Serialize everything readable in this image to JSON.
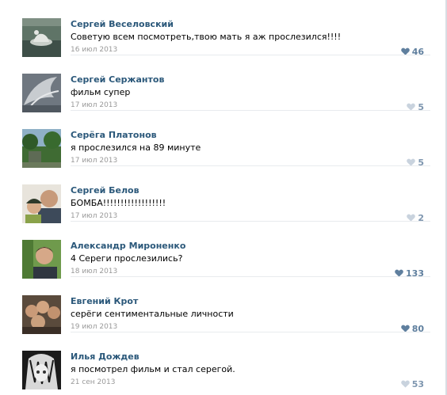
{
  "comments": [
    {
      "author": "Сергей Веселовский",
      "text": "Советую всем посмотреть,твою мать я аж прослезился!!!!",
      "date": "16 июл 2013",
      "likes": "46",
      "avatar_icon": "avatar-photo-swan",
      "heart_color": "#5f7f9e"
    },
    {
      "author": "Сергей Сержантов",
      "text": "фильм супер",
      "date": "17 июл 2013",
      "likes": "5",
      "avatar_icon": "avatar-photo-wings",
      "heart_color": "#c9d3de"
    },
    {
      "author": "Серёга Платонов",
      "text": "я прослезился на 89 минуте",
      "date": "17 июл 2013",
      "likes": "5",
      "avatar_icon": "avatar-photo-park",
      "heart_color": "#c9d3de"
    },
    {
      "author": "Сергей Белов",
      "text": "БОМБА!!!!!!!!!!!!!!!!!!",
      "date": "17 июл 2013",
      "likes": "2",
      "avatar_icon": "avatar-photo-selfie",
      "heart_color": "#c9d3de"
    },
    {
      "author": "Александр Мироненко",
      "text": "4 Сереги прослезились?",
      "date": "18 июл 2013",
      "likes": "133",
      "avatar_icon": "avatar-photo-man",
      "heart_color": "#5f7f9e"
    },
    {
      "author": "Евгений Крот",
      "text": "серёги сентиментальные личности",
      "date": "19 июл 2013",
      "likes": "80",
      "avatar_icon": "avatar-photo-group",
      "heart_color": "#5f7f9e"
    },
    {
      "author": "Илья Дождев",
      "text": "я посмотрел фильм и стал серегой.",
      "date": "21 сен 2013",
      "likes": "53",
      "avatar_icon": "avatar-photo-anime",
      "heart_color": "#c9d3de"
    }
  ],
  "colors": {
    "author_link": "#2b587a",
    "date": "#999999",
    "like_active": "#5f7f9e",
    "like_inactive": "#c9d3de",
    "divider": "#e8ebee"
  }
}
